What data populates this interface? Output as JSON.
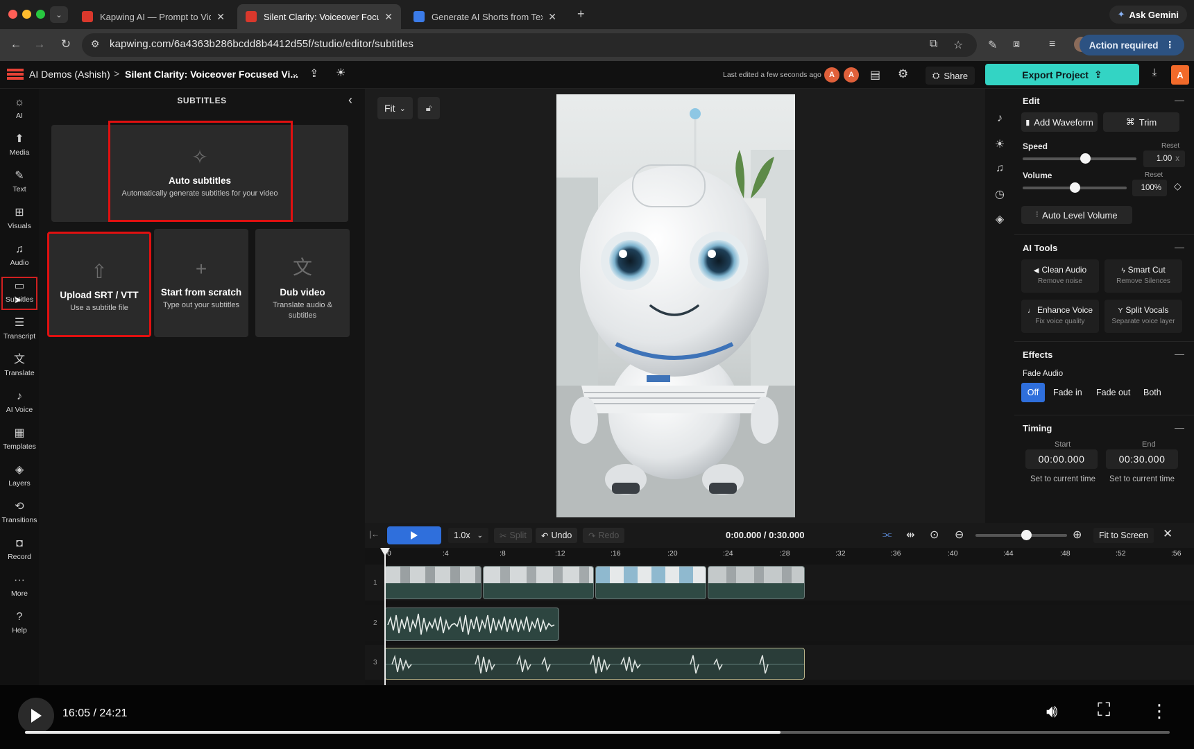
{
  "browser": {
    "tabs": [
      {
        "label": "Kapwing AI — Prompt to Vide",
        "active": false
      },
      {
        "label": "Silent Clarity: Voiceover Focu",
        "active": true
      },
      {
        "label": "Generate AI Shorts from Text",
        "active": false
      }
    ],
    "new_tab": "+",
    "ask_gemini": "Ask Gemini",
    "url": "kapwing.com/6a4363b286bcdd8b4412d55f/studio/editor/subtitles",
    "action_required": "Action required"
  },
  "header": {
    "workspace": "AI Demos (Ashish)",
    "breadcrumb_sep": ">",
    "project_title": "Silent Clarity: Voiceover Focused Vi...",
    "last_edited": "Last edited a few seconds ago",
    "avatars": [
      "A",
      "A"
    ],
    "share": "Share",
    "export": "Export Project",
    "user_avatar": "A"
  },
  "left_rail": [
    {
      "label": "AI",
      "icon": "ai-icon"
    },
    {
      "label": "Media",
      "icon": "media-icon"
    },
    {
      "label": "Text",
      "icon": "text-icon"
    },
    {
      "label": "Visuals",
      "icon": "visuals-icon"
    },
    {
      "label": "Audio",
      "icon": "audio-icon"
    },
    {
      "label": "Subtitles",
      "icon": "subtitles-icon"
    },
    {
      "label": "Transcript",
      "icon": "transcript-icon"
    },
    {
      "label": "Translate",
      "icon": "translate-icon"
    },
    {
      "label": "AI Voice",
      "icon": "ai-voice-icon"
    },
    {
      "label": "Templates",
      "icon": "templates-icon"
    },
    {
      "label": "Layers",
      "icon": "layers-icon"
    },
    {
      "label": "Transitions",
      "icon": "transitions-icon"
    },
    {
      "label": "Record",
      "icon": "record-icon"
    },
    {
      "label": "More",
      "icon": "more-icon"
    },
    {
      "label": "Help",
      "icon": "help-icon"
    }
  ],
  "subtitles_panel": {
    "title": "SUBTITLES",
    "auto": {
      "title": "Auto subtitles",
      "sub": "Automatically generate subtitles for your video"
    },
    "upload": {
      "title": "Upload SRT / VTT",
      "sub": "Use a subtitle file"
    },
    "scratch": {
      "title": "Start from scratch",
      "sub": "Type out your subtitles"
    },
    "dub": {
      "title": "Dub video",
      "sub": "Translate audio & subtitles"
    }
  },
  "preview": {
    "fit": "Fit"
  },
  "properties": {
    "edit": {
      "title": "Edit",
      "add_waveform": "Add Waveform",
      "trim": "Trim",
      "speed_label": "Speed",
      "speed_reset": "Reset",
      "speed_value": "1.00",
      "speed_unit": "x",
      "speed_level": 0.55,
      "volume_label": "Volume",
      "volume_reset": "Reset",
      "volume_value": "100%",
      "volume_level": 0.5,
      "auto_level": "Auto Level Volume"
    },
    "ai_tools": {
      "title": "AI Tools",
      "items": [
        {
          "title": "Clean Audio",
          "sub": "Remove noise"
        },
        {
          "title": "Smart Cut",
          "sub": "Remove Silences"
        },
        {
          "title": "Enhance Voice",
          "sub": "Fix voice quality"
        },
        {
          "title": "Split Vocals",
          "sub": "Separate voice layer"
        }
      ]
    },
    "effects": {
      "title": "Effects",
      "fade_label": "Fade Audio",
      "options": [
        "Off",
        "Fade in",
        "Fade out",
        "Both"
      ],
      "selected": "Off"
    },
    "timing": {
      "title": "Timing",
      "start_label": "Start",
      "end_label": "End",
      "start": "00:00.000",
      "end": "00:30.000",
      "set_current": "Set to current time"
    }
  },
  "timeline": {
    "speed": "1.0x",
    "split": "Split",
    "undo": "Undo",
    "redo": "Redo",
    "timecode": "0:00.000 / 0:30.000",
    "fit_screen": "Fit to Screen",
    "ticks": [
      "0",
      ":4",
      ":8",
      ":12",
      ":16",
      ":20",
      ":24",
      ":28",
      ":32",
      ":36",
      ":40",
      ":44",
      ":48",
      ":52",
      ":56"
    ],
    "tracks": [
      "1",
      "2",
      "3"
    ],
    "zoom_level": 0.55
  },
  "player": {
    "time": "16:05 / 24:21",
    "progress": 0.66
  },
  "colors": {
    "accent": "#33d4c4",
    "highlight": "#e01010",
    "primary_blue": "#2f6fdc"
  }
}
